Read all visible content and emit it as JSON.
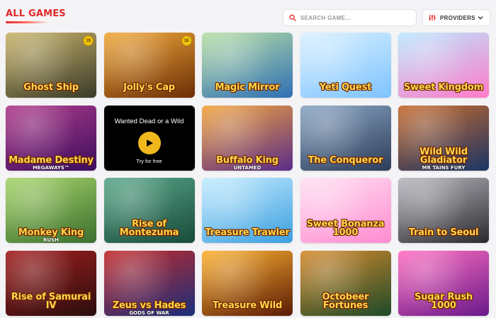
{
  "header": {
    "title": "ALL GAMES",
    "search": {
      "placeholder": "SEARCH GAME...",
      "value": "",
      "icon": "search-icon"
    },
    "providers": {
      "label": "PROVIDERS",
      "icon": "sliders-icon"
    }
  },
  "games": [
    {
      "name": "Ghost Ship",
      "sub": "",
      "colors": [
        "#3a3a2a",
        "#c9b46a"
      ],
      "badge": "1$"
    },
    {
      "name": "Jolly's Cap",
      "sub": "",
      "colors": [
        "#6b2d05",
        "#f2a93b"
      ],
      "badge": "1$"
    },
    {
      "name": "Magic Mirror",
      "sub": "",
      "colors": [
        "#2f6fb5",
        "#b9e0a5"
      ],
      "badge": ""
    },
    {
      "name": "Yeti Quest",
      "sub": "",
      "colors": [
        "#7ec3ff",
        "#d9f0ff"
      ],
      "badge": ""
    },
    {
      "name": "Sweet Kingdom",
      "sub": "",
      "colors": [
        "#ff7ac8",
        "#b8e8ff"
      ],
      "badge": ""
    },
    {
      "name": "Madame Destiny",
      "sub": "MEGAWAYS™",
      "colors": [
        "#3b0d5c",
        "#b03b8c"
      ],
      "badge": ""
    },
    {
      "name": "Wanted Dead or a Wild",
      "sub": "Try for free",
      "video": true
    },
    {
      "name": "Buffalo King",
      "sub": "UNTAMED",
      "colors": [
        "#5a2c8a",
        "#f3a43b"
      ],
      "badge": ""
    },
    {
      "name": "The Conqueror",
      "sub": "",
      "colors": [
        "#2d3c5a",
        "#8aa6c4"
      ],
      "badge": ""
    },
    {
      "name": "Wild Wild Gladiator",
      "sub": "MR TAINS FURY",
      "colors": [
        "#1b3566",
        "#c76b2c"
      ],
      "badge": ""
    },
    {
      "name": "Monkey King",
      "sub": "RUSH",
      "colors": [
        "#3b6e2f",
        "#a7d56a"
      ],
      "badge": ""
    },
    {
      "name": "Rise of Montezuma",
      "sub": "",
      "colors": [
        "#184a3a",
        "#5aa88a"
      ],
      "badge": ""
    },
    {
      "name": "Treasure Trawler",
      "sub": "",
      "colors": [
        "#3b9fe0",
        "#c5ecff"
      ],
      "badge": ""
    },
    {
      "name": "Sweet Bonanza 1000",
      "sub": "",
      "colors": [
        "#ff8bd0",
        "#ffe0f2"
      ],
      "badge": ""
    },
    {
      "name": "Train to Seoul",
      "sub": "",
      "colors": [
        "#2a2a2e",
        "#b8b8c0"
      ],
      "badge": ""
    },
    {
      "name": "Rise of Samurai IV",
      "sub": "",
      "colors": [
        "#2a0d0d",
        "#a31f1f"
      ],
      "badge": ""
    },
    {
      "name": "Zeus vs Hades",
      "sub": "GODS OF WAR",
      "colors": [
        "#1a2f7a",
        "#c42a2a"
      ],
      "badge": ""
    },
    {
      "name": "Treasure Wild",
      "sub": "",
      "colors": [
        "#5a1a06",
        "#ffb330"
      ],
      "badge": ""
    },
    {
      "name": "Octobeer Fortunes",
      "sub": "",
      "colors": [
        "#1d4a2a",
        "#d68a2c"
      ],
      "badge": ""
    },
    {
      "name": "Sugar Rush 1000",
      "sub": "",
      "colors": [
        "#6a1a8a",
        "#ff6fc1"
      ],
      "badge": ""
    }
  ]
}
